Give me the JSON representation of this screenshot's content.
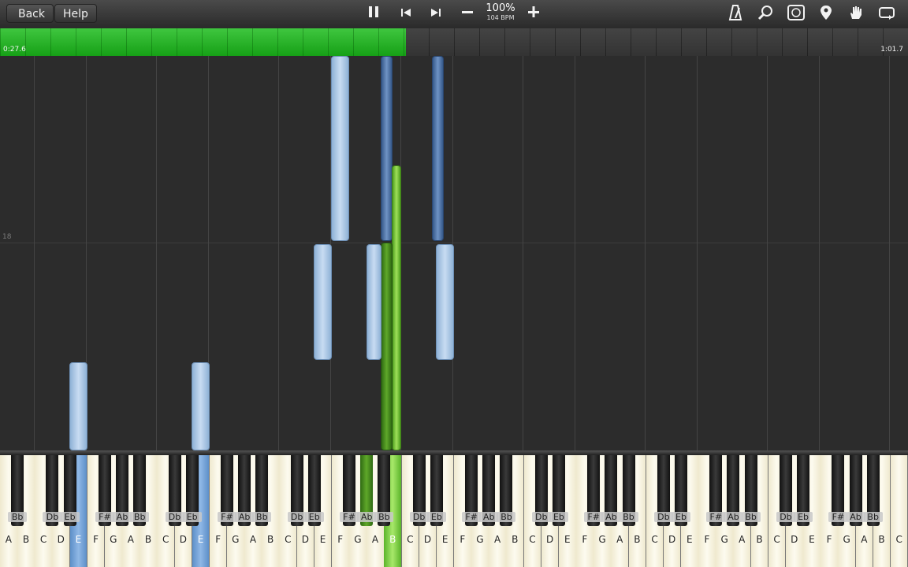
{
  "toolbar": {
    "back_label": "Back",
    "help_label": "Help",
    "tempo_percent": "100%",
    "tempo_bpm": "104 BPM",
    "icons": [
      "pause-icon",
      "skip-back-icon",
      "skip-forward-icon",
      "minus-icon",
      "plus-icon",
      "metronome-icon",
      "magnifier-icon",
      "note-label-icon",
      "location-pin-icon",
      "hand-icon",
      "loop-icon"
    ]
  },
  "timeline": {
    "elapsed": "0:27.6",
    "total": "1:01.7",
    "progress_fraction": 0.447
  },
  "roll": {
    "measure_number": "18"
  },
  "keyboard": {
    "white_keys": [
      "A",
      "B",
      "C",
      "D",
      "E",
      "F",
      "G",
      "A",
      "B",
      "C",
      "D",
      "E",
      "F",
      "G",
      "A",
      "B",
      "C",
      "D",
      "E",
      "F",
      "G",
      "A",
      "B",
      "C",
      "D",
      "E",
      "F",
      "G",
      "A",
      "B",
      "C",
      "D",
      "E",
      "F",
      "G",
      "A",
      "B",
      "C",
      "D",
      "E",
      "F",
      "G",
      "A",
      "B",
      "C",
      "D",
      "E",
      "F",
      "G",
      "A",
      "B",
      "C"
    ],
    "black_label_pattern": [
      "Bb",
      "Db",
      "Eb",
      "F#",
      "Ab"
    ],
    "highlighted_white": {
      "4": "blue",
      "11": "blue",
      "22": "green"
    },
    "highlighted_black_index": 14
  },
  "colors": {
    "progress": "#22b022",
    "note_light": "#b4cce8",
    "note_dark": "#4a6fa5",
    "note_green": "#7fd03f"
  }
}
